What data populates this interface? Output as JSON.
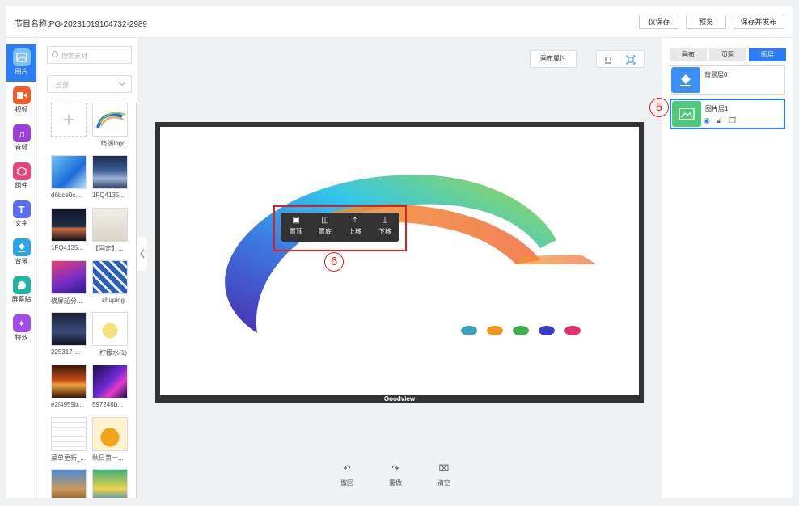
{
  "header": {
    "program_label": "节目名称:",
    "program_name": "PG-20231019104732-2989",
    "save_only": "仅保存",
    "preview": "预览",
    "save_publish": "保存并发布"
  },
  "rail": {
    "items": [
      {
        "label": "图片",
        "icon": "image-icon",
        "color": "#2a7df5"
      },
      {
        "label": "视频",
        "icon": "video-icon",
        "color": "#f25b2a"
      },
      {
        "label": "音频",
        "icon": "music-icon",
        "color": "#9b3fd6"
      },
      {
        "label": "组件",
        "icon": "component-icon",
        "color": "#e8457d"
      },
      {
        "label": "文字",
        "icon": "text-icon",
        "color": "#5b6ef0"
      },
      {
        "label": "背景",
        "icon": "background-icon",
        "color": "#2aa6e8"
      },
      {
        "label": "屏幕贴",
        "icon": "sticker-icon",
        "color": "#1fb5a2"
      },
      {
        "label": "特效",
        "icon": "effects-icon",
        "color": "#a24be8"
      }
    ]
  },
  "materials": {
    "search_placeholder": "搜索素材",
    "filter_value": "全部",
    "items": [
      {
        "label": ""
      },
      {
        "label": "终端logo"
      },
      {
        "label": "d6bce0c..."
      },
      {
        "label": "1FQ4135..."
      },
      {
        "label": "1FQ4135..."
      },
      {
        "label": "【固定】..."
      },
      {
        "label": "横屏超分..."
      },
      {
        "label": "shuping"
      },
      {
        "label": "225317-..."
      },
      {
        "label": "柠檬水(1)"
      },
      {
        "label": "e2f4959b..."
      },
      {
        "label": "597246b..."
      },
      {
        "label": "菜单更新_..."
      },
      {
        "label": "秋日第一..."
      },
      {
        "label": ""
      },
      {
        "label": ""
      }
    ]
  },
  "toolbar": {
    "canvas_props": "画布属性"
  },
  "stage": {
    "watermark": "Goodview",
    "dot_colors": [
      "#3aa0c0",
      "#f0961e",
      "#3cb04a",
      "#3c3cc8",
      "#e0306e"
    ]
  },
  "context_menu": {
    "to_top": "置顶",
    "to_bottom": "置底",
    "move_up": "上移",
    "move_down": "下移"
  },
  "callouts": {
    "five": "5",
    "six": "6"
  },
  "bottom_tools": {
    "undo": "撤回",
    "redo": "重做",
    "clear": "清空"
  },
  "right_panel": {
    "tabs": [
      "画布",
      "页面",
      "图层"
    ],
    "active_tab": "图层",
    "layers": [
      {
        "name": "背景层0",
        "icon": "paint-bucket-icon",
        "color": "#3b8ff5"
      },
      {
        "name": "图片层1",
        "icon": "image-icon",
        "color": "#4ec97a"
      }
    ]
  }
}
